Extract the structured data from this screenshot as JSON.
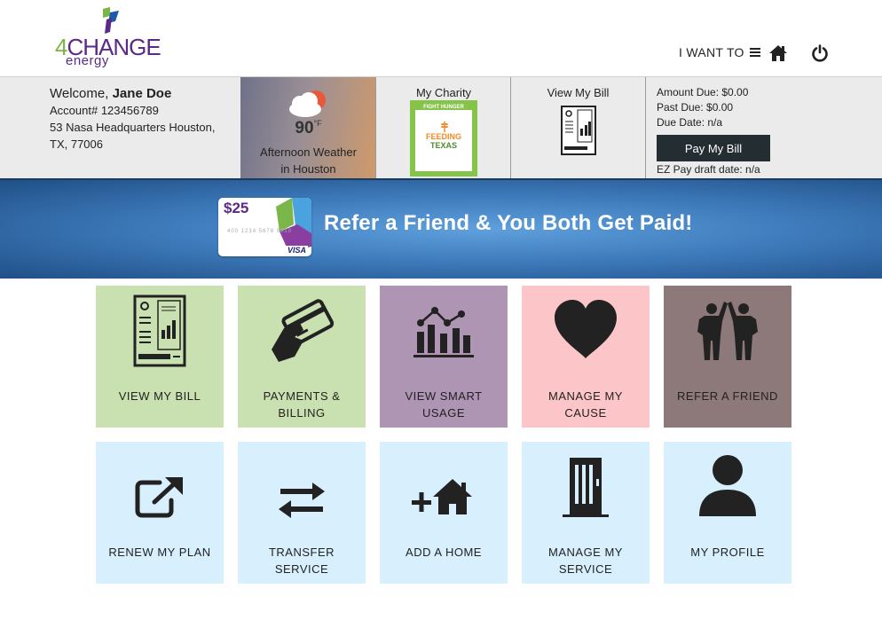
{
  "brand": {
    "logo_num": "4",
    "logo_word": "CHANGE",
    "logo_sub": "energy"
  },
  "nav": {
    "i_want_to": "I WANT TO",
    "home_icon": "home-icon",
    "power_icon": "power-icon"
  },
  "account": {
    "welcome_prefix": "Welcome,",
    "name": "Jane Doe",
    "account_number": "Account# 123456789",
    "address_line1": "53 Nasa Headquarters Houston,",
    "address_line2": "TX, 77006"
  },
  "weather": {
    "temp": "90",
    "unit": "°F",
    "label_line1": "Afternoon Weather",
    "label_line2": "in Houston"
  },
  "charity": {
    "title": "My Charity",
    "badge_top": "FIGHT HUNGER",
    "name_line1": "FEEDING",
    "name_line2": "TEXAS"
  },
  "bill": {
    "title": "View My Bill",
    "amount_due": "Amount Due: $0.00",
    "past_due": "Past Due: $0.00",
    "due_date": "Due Date: n/a",
    "pay_button": "Pay My Bill",
    "ez_pay": "EZ Pay draft date: n/a"
  },
  "banner": {
    "card_amount": "$25",
    "card_numbers": "400 1234 5678 9010",
    "card_brand": "VISA",
    "text": "Refer a Friend & You Both Get Paid!"
  },
  "tiles_row1": [
    {
      "line1": "VIEW MY BILL",
      "line2": "",
      "icon": "bill-icon",
      "color": "#c9e1b0"
    },
    {
      "line1": "PAYMENTS &",
      "line2": "BILLING",
      "icon": "credit-card-hand-icon",
      "color": "#c9e1b0"
    },
    {
      "line1": "VIEW SMART",
      "line2": "USAGE",
      "icon": "usage-chart-icon",
      "color": "#ad95b3"
    },
    {
      "line1": "MANAGE MY",
      "line2": "CAUSE",
      "icon": "heart-icon",
      "color": "#fcc5c7"
    },
    {
      "line1": "REFER A FRIEND",
      "line2": "",
      "icon": "high-five-icon",
      "color": "#8d7979"
    }
  ],
  "tiles_row2": [
    {
      "line1": "RENEW MY PLAN",
      "line2": "",
      "icon": "external-link-icon",
      "color": "#d8f0fd"
    },
    {
      "line1": "TRANSFER",
      "line2": "SERVICE",
      "icon": "transfer-arrows-icon",
      "color": "#d8f0fd"
    },
    {
      "line1": "ADD A HOME",
      "line2": "",
      "icon": "add-home-icon",
      "color": "#d8f0fd"
    },
    {
      "line1": "MANAGE MY",
      "line2": "SERVICE",
      "icon": "door-icon",
      "color": "#d8f0fd"
    },
    {
      "line1": "MY PROFILE",
      "line2": "",
      "icon": "user-icon",
      "color": "#d8f0fd"
    }
  ]
}
